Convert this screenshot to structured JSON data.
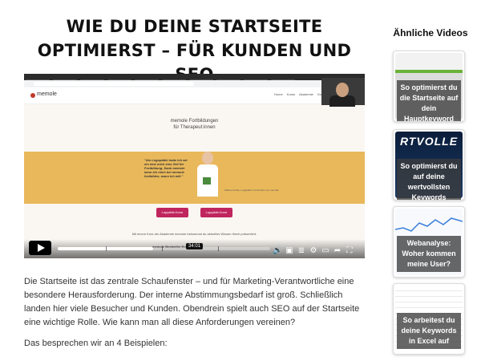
{
  "article": {
    "title_line1": "WIE DU DEINE STARTSEITE",
    "title_line2": "OPTIMIERST – FÜR KUNDEN UND SEO",
    "paragraph": "Die Startseite ist das zentrale Schaufenster – und für Marketing-Verantwortliche eine besondere Herausforderung. Der interne Abstimmungsbedarf ist groß. Schließlich landen hier viele Besucher und Kunden. Obendrein spielt auch SEO auf der Startseite eine wichtige Rolle. Wie kann man all diese Anforderungen vereinen?",
    "paragraph2": "Das besprechen wir an 4 Beispielen:"
  },
  "video": {
    "site_logo": "memole",
    "site_nav": "Home Kurse Akademie Dozenten",
    "hero_line1": "memole Fortbildungen",
    "hero_line2": "für Therapeut:innen",
    "quote": "\"Als Logopädin habe ich wir ein eine mich eine Zeit für Fortbildung. Dank memole kann ich mich bei memole fortbilden, wann ich will.\"",
    "person_caption": "Sabine Kunde, Logopädin und Kundin von memole",
    "button1": "Logopädie-Kurse",
    "button2": "Logopädie-Kurse",
    "lower_text": "Mit einem Kurs der Akademie memole bekommst du aktuelles Wissen frisch präsentiert.",
    "lower_sub": "memole Bestseller Kurse",
    "timecode": "34:01",
    "progress": 0.45,
    "controls": [
      "play-icon",
      "volume-icon",
      "captions-icon",
      "transcript-icon",
      "settings-icon",
      "pip-icon",
      "share-icon",
      "fullscreen-icon"
    ]
  },
  "sidebar": {
    "title": "Ähnliche Videos",
    "items": [
      {
        "label": "So optimierst du die Startseite auf dein Hauptkeyword",
        "thumb_text": ""
      },
      {
        "label": "So optimierst du auf deine wertvollsten Keywords",
        "thumb_text": "RTVOLLE"
      },
      {
        "label": "Webanalyse: Woher kommen meine User?",
        "thumb_text": ""
      },
      {
        "label": "So arbeitest du deine Keywords in Excel auf",
        "thumb_text": ""
      }
    ]
  }
}
